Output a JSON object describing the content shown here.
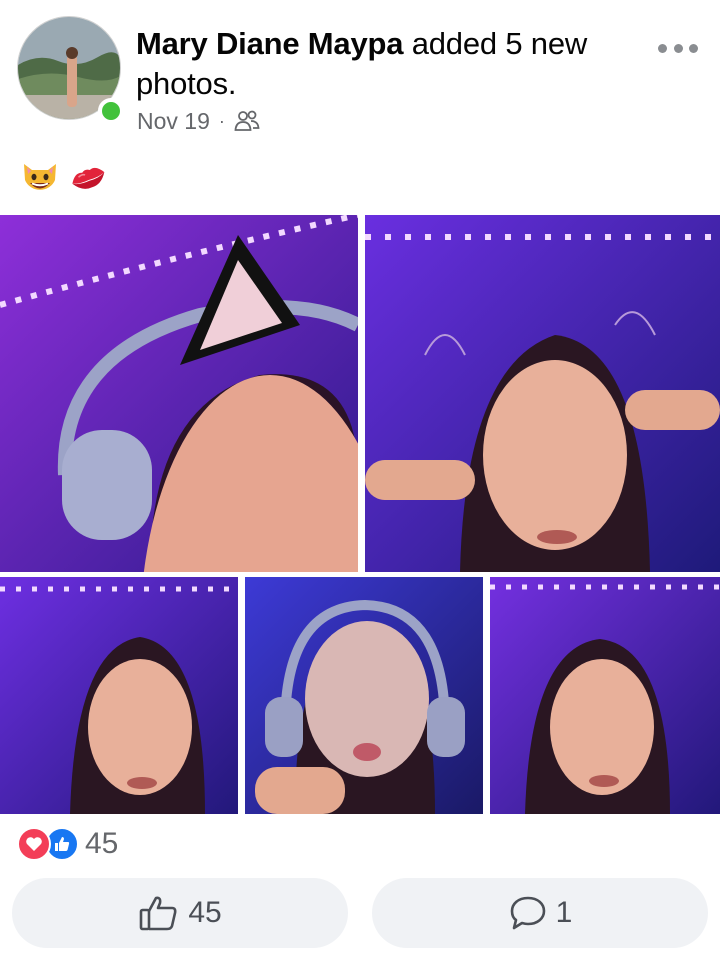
{
  "post": {
    "author": "Mary Diane Maypa",
    "action_text": "added 5 new photos.",
    "date": "Nov 19",
    "separator": "·",
    "audience_icon": "friends-icon",
    "caption_emojis": [
      "grinning-cat-emoji",
      "kiss-mark-emoji"
    ],
    "photo_count": 5
  },
  "reactions": {
    "types": [
      "love-reaction-icon",
      "like-reaction-icon"
    ],
    "count": "45"
  },
  "actions": {
    "like_count": "45",
    "comment_count": "1"
  },
  "colors": {
    "online": "#42c23b",
    "love": "#f33e58",
    "like": "#1877f2",
    "button_bg": "#f0f2f5",
    "meta_text": "#65676b"
  }
}
